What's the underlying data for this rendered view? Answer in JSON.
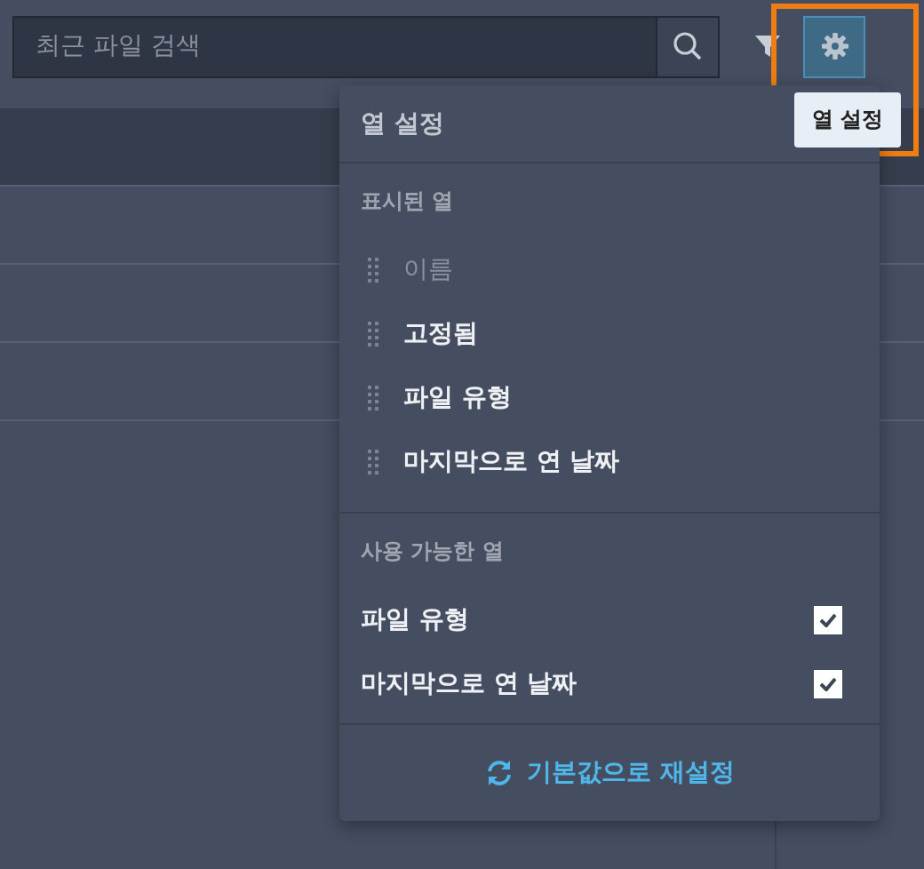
{
  "search": {
    "placeholder": "최근 파일 검색"
  },
  "tooltip": "열 설정",
  "column_settings": {
    "title": "열 설정",
    "shown_heading": "표시된 열",
    "shown": [
      {
        "label": "이름",
        "disabled": true
      },
      {
        "label": "고정됨",
        "disabled": false
      },
      {
        "label": "파일 유형",
        "disabled": false
      },
      {
        "label": "마지막으로 연 날짜",
        "disabled": false
      }
    ],
    "available_heading": "사용 가능한 열",
    "available": [
      {
        "label": "파일 유형",
        "checked": true
      },
      {
        "label": "마지막으로 연 날짜",
        "checked": true
      }
    ],
    "reset": "기본값으로 재설정"
  }
}
